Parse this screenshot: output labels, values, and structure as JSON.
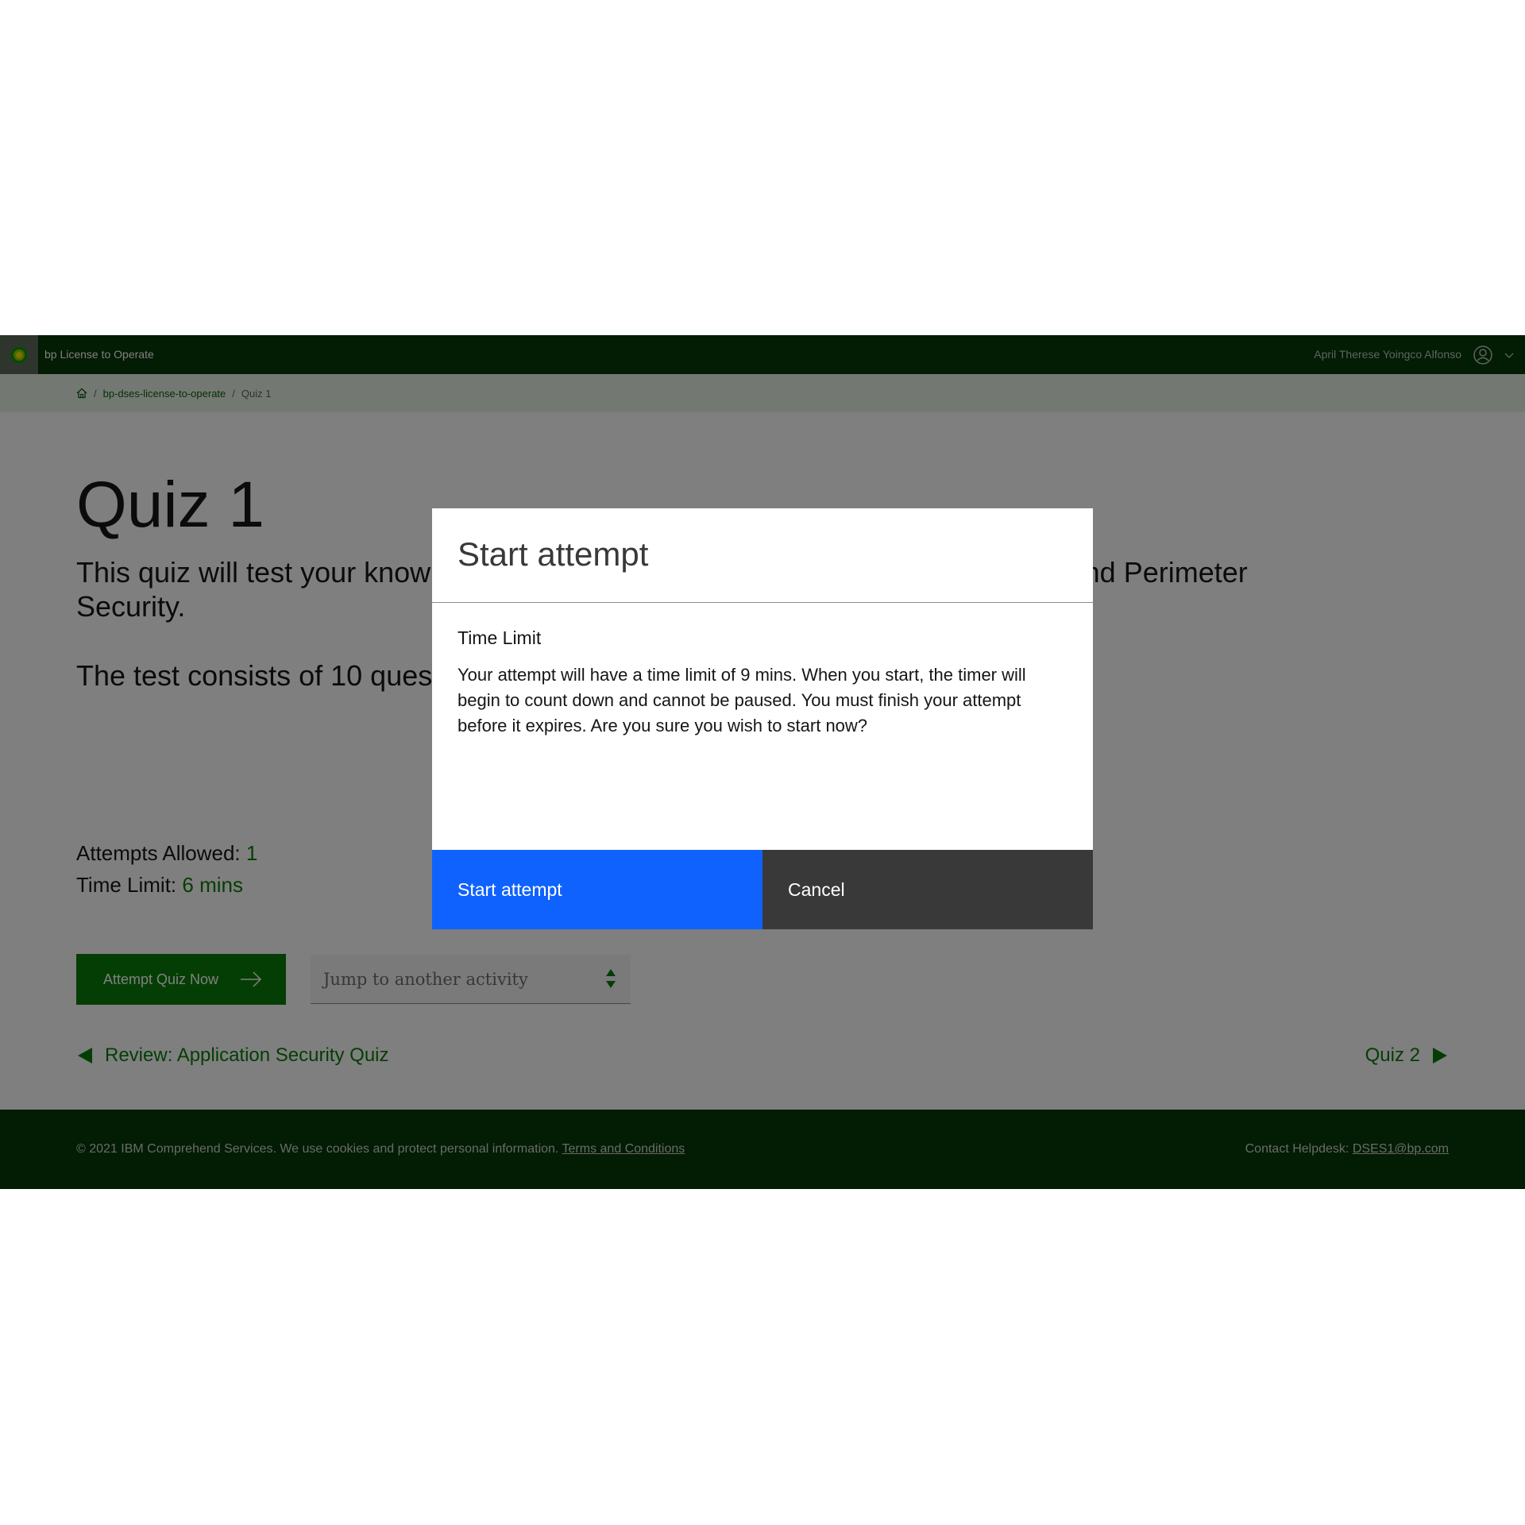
{
  "header": {
    "app_name": "bp License to Operate",
    "user_name": "April Therese Yoingco Alfonso",
    "logo_icon": "bp-helios-logo"
  },
  "breadcrumb": {
    "home_icon": "home-icon",
    "course": "bp-dses-license-to-operate",
    "current": "Quiz 1",
    "separator": "/"
  },
  "page": {
    "title": "Quiz 1",
    "description": "This quiz will test your knowledge of the topics covered in Application Security and Perimeter Security.",
    "note": "The test consists of 10 questions."
  },
  "meta": {
    "attempts_label": "Attempts Allowed:",
    "attempts_value": "1",
    "time_label": "Time Limit:",
    "time_value": "6 mins"
  },
  "actions": {
    "attempt_button": "Attempt Quiz Now",
    "jump_placeholder": "Jump to another activity"
  },
  "navigation": {
    "prev_label": "Review: Application Security Quiz",
    "next_label": "Quiz 2"
  },
  "footer": {
    "copyright": "© 2021 IBM Comprehend Services. We use cookies and protect personal information.",
    "terms_link": "Terms and Conditions",
    "helpdesk_label": "Contact Helpdesk:",
    "helpdesk_email": "DSES1@bp.com"
  },
  "modal": {
    "title": "Start attempt",
    "subtitle": "Time Limit",
    "body": "Your attempt will have a time limit of 9 mins. When you start, the timer will begin to count down and cannot be paused. You must finish your attempt before it expires. Are you sure you wish to start now?",
    "primary_button": "Start attempt",
    "secondary_button": "Cancel"
  },
  "colors": {
    "header_bg": "#063808",
    "accent_green": "#0a7c0a",
    "primary_blue": "#0f62fe",
    "secondary_gray": "#393939"
  }
}
